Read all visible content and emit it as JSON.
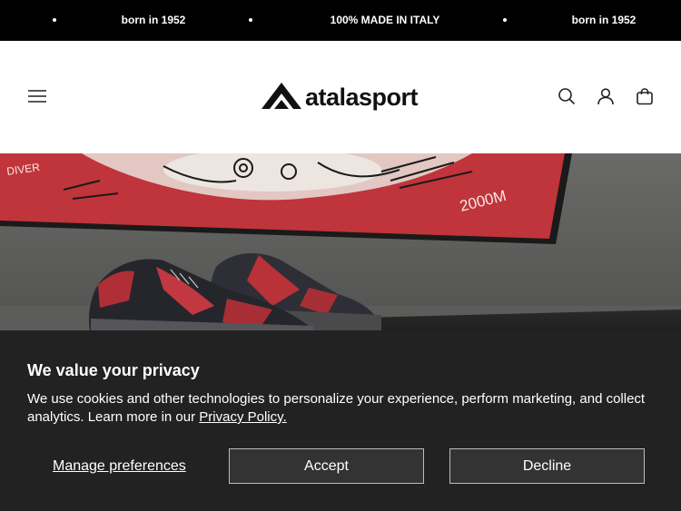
{
  "announcement": {
    "items": [
      "born in 1952",
      "100% MADE IN ITALY",
      "born in 1952"
    ]
  },
  "header": {
    "brand": "atalasport",
    "icons": [
      "menu-icon",
      "search-icon",
      "account-icon",
      "cart-icon"
    ]
  },
  "hero": {
    "image": "sneakers-on-shelf-with-graffiti-artwork",
    "artwork_text": [
      "DIVER",
      "2000M"
    ]
  },
  "cookie": {
    "title": "We value your privacy",
    "text": "We use cookies and other technologies to personalize your experience, perform marketing, and collect analytics. Learn more in our ",
    "link": "Privacy Policy.",
    "manage": "Manage preferences",
    "accept": "Accept",
    "decline": "Decline"
  },
  "colors": {
    "announcement_bg": "#000000",
    "banner_bg": "#222222",
    "button_bg": "#333333",
    "button_border": "#bdbdbd",
    "artwork_red": "#c0343b"
  }
}
